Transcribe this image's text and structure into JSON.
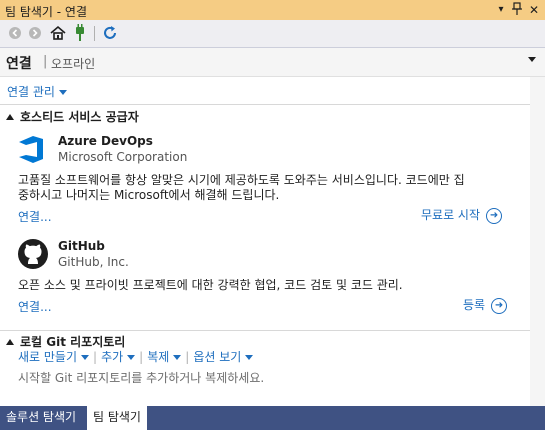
{
  "window": {
    "title": "팀 탐색기 - 연결",
    "title_buttons": [
      "dropdown",
      "pin",
      "close"
    ]
  },
  "toolbar": {
    "icons": [
      "back-icon",
      "forward-icon",
      "home-icon",
      "connect-icon",
      "refresh-icon"
    ]
  },
  "header": {
    "title": "연결",
    "divider": "|",
    "subtitle": "오프라인"
  },
  "manage": {
    "label": "연결 관리"
  },
  "hosted": {
    "heading": "호스티드 서비스 공급자",
    "providers": [
      {
        "name": "Azure DevOps",
        "company": "Microsoft Corporation",
        "description_line1": "고품질 소프트웨어를 항상 알맞은 시기에 제공하도록 도와주는 서비스입니다. 코드에만 집",
        "description_line2": "중하시고 나머지는 Microsoft에서 해결해 드립니다.",
        "connect_label": "연결...",
        "action_label": "무료로 시작"
      },
      {
        "name": "GitHub",
        "company": "GitHub, Inc.",
        "description_line1": "오픈 소스 및 프라이빗 프로젝트에 대한 강력한 협업, 코드 검토 및 코드 관리.",
        "connect_label": "연결...",
        "action_label": "등록"
      }
    ]
  },
  "local_git": {
    "heading": "로컬 Git 리포지토리",
    "actions": [
      "새로 만들기",
      "추가",
      "복제",
      "옵션 보기"
    ],
    "hint": "시작할 Git 리포지토리를 추가하거나 복제하세요."
  },
  "bottom_tabs": [
    {
      "label": "솔루션 탐색기",
      "active": false
    },
    {
      "label": "팀 탐색기",
      "active": true
    }
  ],
  "colors": {
    "titlebar": "#f5cc84",
    "accent_link": "#1e6ebe",
    "bottom_tabs_bg": "#3f5283",
    "azure_blue": "#0078d4"
  }
}
